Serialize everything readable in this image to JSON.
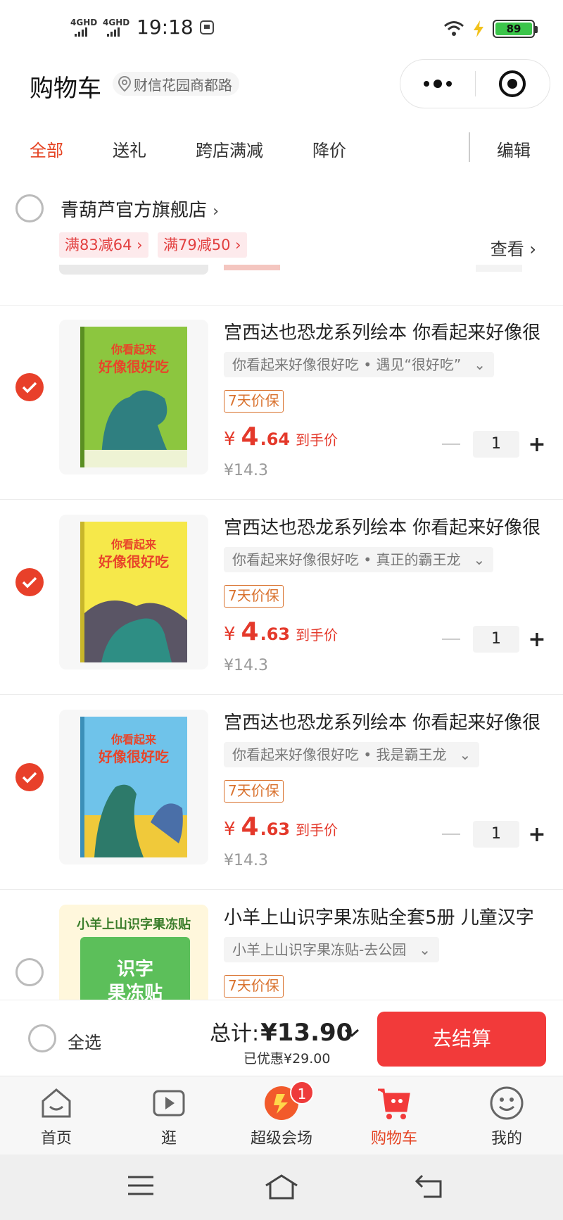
{
  "status_bar": {
    "signal_1": "4GHD",
    "signal_2": "4GHD",
    "time": "19:18",
    "battery": "89"
  },
  "header": {
    "title": "购物车",
    "location": "财信花园商都路"
  },
  "tabs": {
    "all": "全部",
    "gift": "送礼",
    "cross_store": "跨店满减",
    "price_drop": "降价",
    "edit": "编辑"
  },
  "shop": {
    "name": "青葫芦官方旗舰店",
    "promo_1": "满83减64",
    "promo_2": "满79减50",
    "view": "查看"
  },
  "items": [
    {
      "title": "宫西达也恐龙系列绘本 你看起来好像很",
      "variant": "你看起来好像很好吃 • 遇见“很好吃”",
      "guarantee": "7天价保",
      "price_int": "4",
      "price_dec": ".64",
      "price_note": "到手价",
      "original": "¥14.3",
      "qty": "1",
      "checked": true
    },
    {
      "title": "宫西达也恐龙系列绘本 你看起来好像很",
      "variant": "你看起来好像很好吃 • 真正的霸王龙",
      "guarantee": "7天价保",
      "price_int": "4",
      "price_dec": ".63",
      "price_note": "到手价",
      "original": "¥14.3",
      "qty": "1",
      "checked": true
    },
    {
      "title": "宫西达也恐龙系列绘本 你看起来好像很",
      "variant": "你看起来好像很好吃 • 我是霸王龙",
      "guarantee": "7天价保",
      "price_int": "4",
      "price_dec": ".63",
      "price_note": "到手价",
      "original": "¥14.3",
      "qty": "1",
      "checked": true
    },
    {
      "title": "小羊上山识字果冻贴全套5册 儿童汉字",
      "variant": "小羊上山识字果冻贴-去公园",
      "guarantee": "7天价保",
      "checked": false
    }
  ],
  "product_art": {
    "book_header": "你看起来",
    "book_title": "好像很好吃",
    "jelly_banner": "小羊上山识字果冻贴",
    "jelly_title_1": "识字",
    "jelly_title_2": "果冻贴"
  },
  "checkout": {
    "select_all": "全选",
    "total_label": "总计:",
    "total_amount": "¥13.90",
    "discount": "已优惠¥29.00",
    "pay_button": "去结算"
  },
  "bottom_nav": {
    "home": "首页",
    "browse": "逛",
    "super_venue": "超级会场",
    "super_badge": "1",
    "cart": "购物车",
    "mine": "我的"
  },
  "colors": {
    "accent": "#e54322",
    "price": "#e4392b",
    "pay_button": "#f23a3a",
    "guarantee": "#d9722e"
  }
}
